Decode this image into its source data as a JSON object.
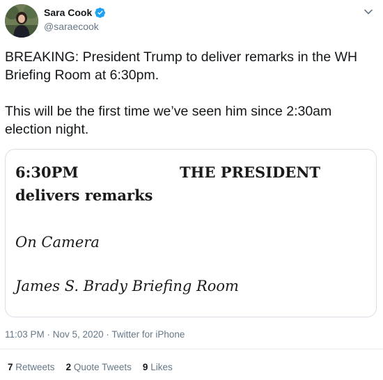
{
  "author": {
    "display_name": "Sara Cook",
    "handle": "@saraecook",
    "verified": true
  },
  "tweet": {
    "paragraphs": [
      "BREAKING: President Trump to deliver remarks in the WH Briefing Room at 6:30pm.",
      "This will be the first time we’ve seen him since 2:30am election night."
    ]
  },
  "card": {
    "time": "6:30PM",
    "who": "THE PRESIDENT",
    "what": "delivers remarks",
    "camera": "On Camera",
    "location": "James S. Brady Briefing Room"
  },
  "meta": {
    "timestamp": "11:03 PM · Nov 5, 2020 · Twitter for iPhone"
  },
  "stats": {
    "retweets_count": "7",
    "retweets_label": "Retweets",
    "quotes_count": "2",
    "quotes_label": "Quote Tweets",
    "likes_count": "9",
    "likes_label": "Likes"
  },
  "colors": {
    "verified_badge": "#1da1f2",
    "secondary_text": "#657786",
    "border": "#d8dee3"
  }
}
